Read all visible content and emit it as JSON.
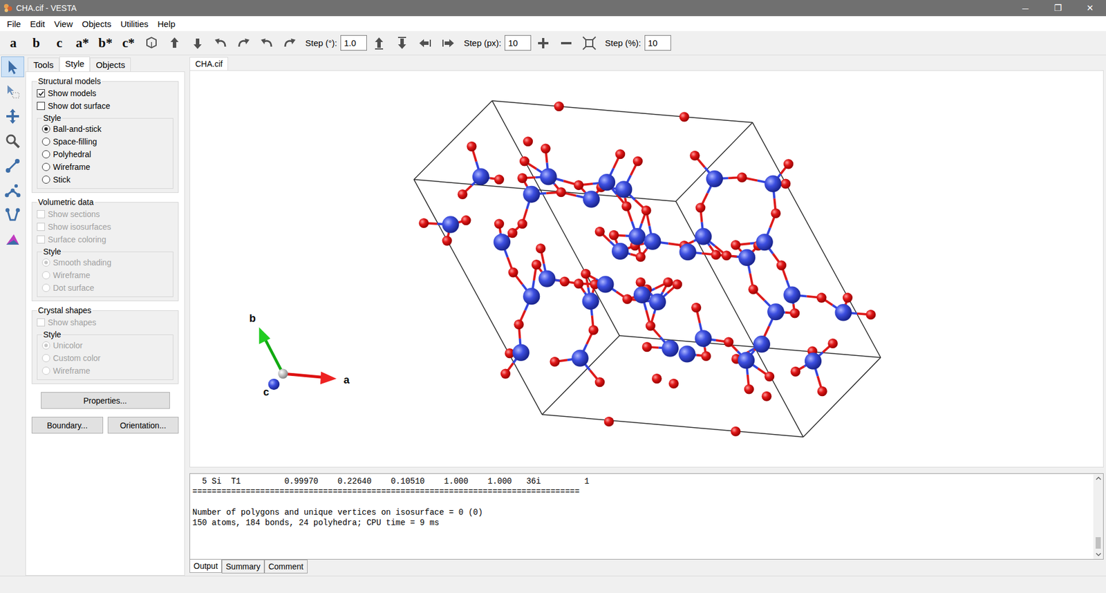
{
  "window": {
    "title": "CHA.cif - VESTA",
    "controls": [
      "─",
      "❐",
      "✕"
    ]
  },
  "menu": [
    "File",
    "Edit",
    "View",
    "Objects",
    "Utilities",
    "Help"
  ],
  "toolbar": {
    "axes": [
      "a",
      "b",
      "c",
      "a*",
      "b*",
      "c*"
    ],
    "steps": [
      {
        "label": "Step (°):",
        "value": "1.0"
      },
      {
        "label": "Step (px):",
        "value": "10"
      },
      {
        "label": "Step (%):",
        "value": "10"
      }
    ]
  },
  "tools": [
    {
      "selected": true
    },
    {
      "selected": false
    },
    {
      "selected": false
    },
    {
      "selected": false
    },
    {
      "selected": false
    },
    {
      "selected": false
    },
    {
      "selected": false
    },
    {
      "selected": false
    }
  ],
  "panel_tabs": [
    {
      "label": "Tools",
      "selected": false
    },
    {
      "label": "Style",
      "selected": true
    },
    {
      "label": "Objects",
      "selected": false
    }
  ],
  "groups": [
    {
      "title": "Structural models",
      "checks": [
        {
          "label": "Show models",
          "checked": true,
          "disabled": false
        },
        {
          "label": "Show dot surface",
          "checked": false,
          "disabled": false
        }
      ],
      "style": {
        "title": "Style",
        "options": [
          {
            "label": "Ball-and-stick",
            "selected": true,
            "disabled": false
          },
          {
            "label": "Space-filling",
            "selected": false,
            "disabled": false
          },
          {
            "label": "Polyhedral",
            "selected": false,
            "disabled": false
          },
          {
            "label": "Wireframe",
            "selected": false,
            "disabled": false
          },
          {
            "label": "Stick",
            "selected": false,
            "disabled": false
          }
        ]
      }
    },
    {
      "title": "Volumetric data",
      "checks": [
        {
          "label": "Show sections",
          "checked": false,
          "disabled": true
        },
        {
          "label": "Show isosurfaces",
          "checked": false,
          "disabled": true
        },
        {
          "label": "Surface coloring",
          "checked": false,
          "disabled": true
        }
      ],
      "style": {
        "title": "Style",
        "options": [
          {
            "label": "Smooth shading",
            "selected": true,
            "disabled": true
          },
          {
            "label": "Wireframe",
            "selected": false,
            "disabled": true
          },
          {
            "label": "Dot surface",
            "selected": false,
            "disabled": true
          }
        ]
      }
    },
    {
      "title": "Crystal shapes",
      "checks": [
        {
          "label": "Show shapes",
          "checked": false,
          "disabled": true
        }
      ],
      "style": {
        "title": "Style",
        "options": [
          {
            "label": "Unicolor",
            "selected": true,
            "disabled": true
          },
          {
            "label": "Custom color",
            "selected": false,
            "disabled": true
          },
          {
            "label": "Wireframe",
            "selected": false,
            "disabled": true
          }
        ]
      }
    }
  ],
  "buttons": [
    [
      "Properties..."
    ],
    [
      "Boundary...",
      "Orientation..."
    ]
  ],
  "file_tabs": [
    {
      "label": "CHA.cif",
      "selected": true
    }
  ],
  "axes_labels": {
    "a": "a",
    "b": "b",
    "c": "c"
  },
  "output": {
    "lines": [
      "  5 Si  T1         0.99970    0.22640    0.10510    1.000    1.000   36i         1",
      "================================================================================",
      "",
      "Number of polygons and unique vertices on isosurface = 0 (0)",
      "150 atoms, 184 bonds, 24 polyhedra; CPU time = 9 ms"
    ]
  },
  "bottom_tabs": [
    {
      "label": "Output",
      "selected": true
    },
    {
      "label": "Summary",
      "selected": false
    },
    {
      "label": "Comment",
      "selected": false
    }
  ]
}
